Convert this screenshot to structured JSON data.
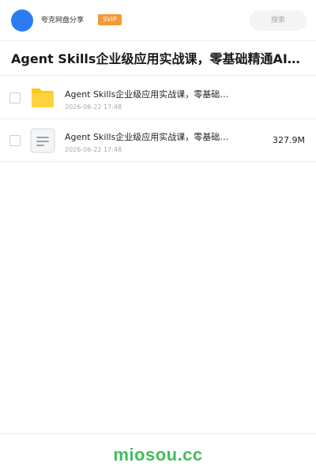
{
  "header": {
    "brand": "夸克网盘分享",
    "badge": "SVIP",
    "search_placeholder": "搜索"
  },
  "title": "Agent Skills企业级应用实战课，零基础精通AI智能体开发",
  "files": [
    {
      "type": "folder",
      "name": "Agent Skills企业级应用实战课，零基础精通AI智能体开发",
      "date": "2026-06-22 17:48",
      "size": ""
    },
    {
      "type": "document",
      "name": "Agent Skills企业级应用实战课，零基础精通AI智能体开发",
      "date": "2026-06-22 17:48",
      "size": "327.9M"
    }
  ],
  "footer": {
    "site": "miosou.cc"
  },
  "colors": {
    "avatar": "#2b7bf3",
    "badge": "#f29a38",
    "folder": "#ffc61b",
    "footer_text": "#3fbf5a"
  }
}
